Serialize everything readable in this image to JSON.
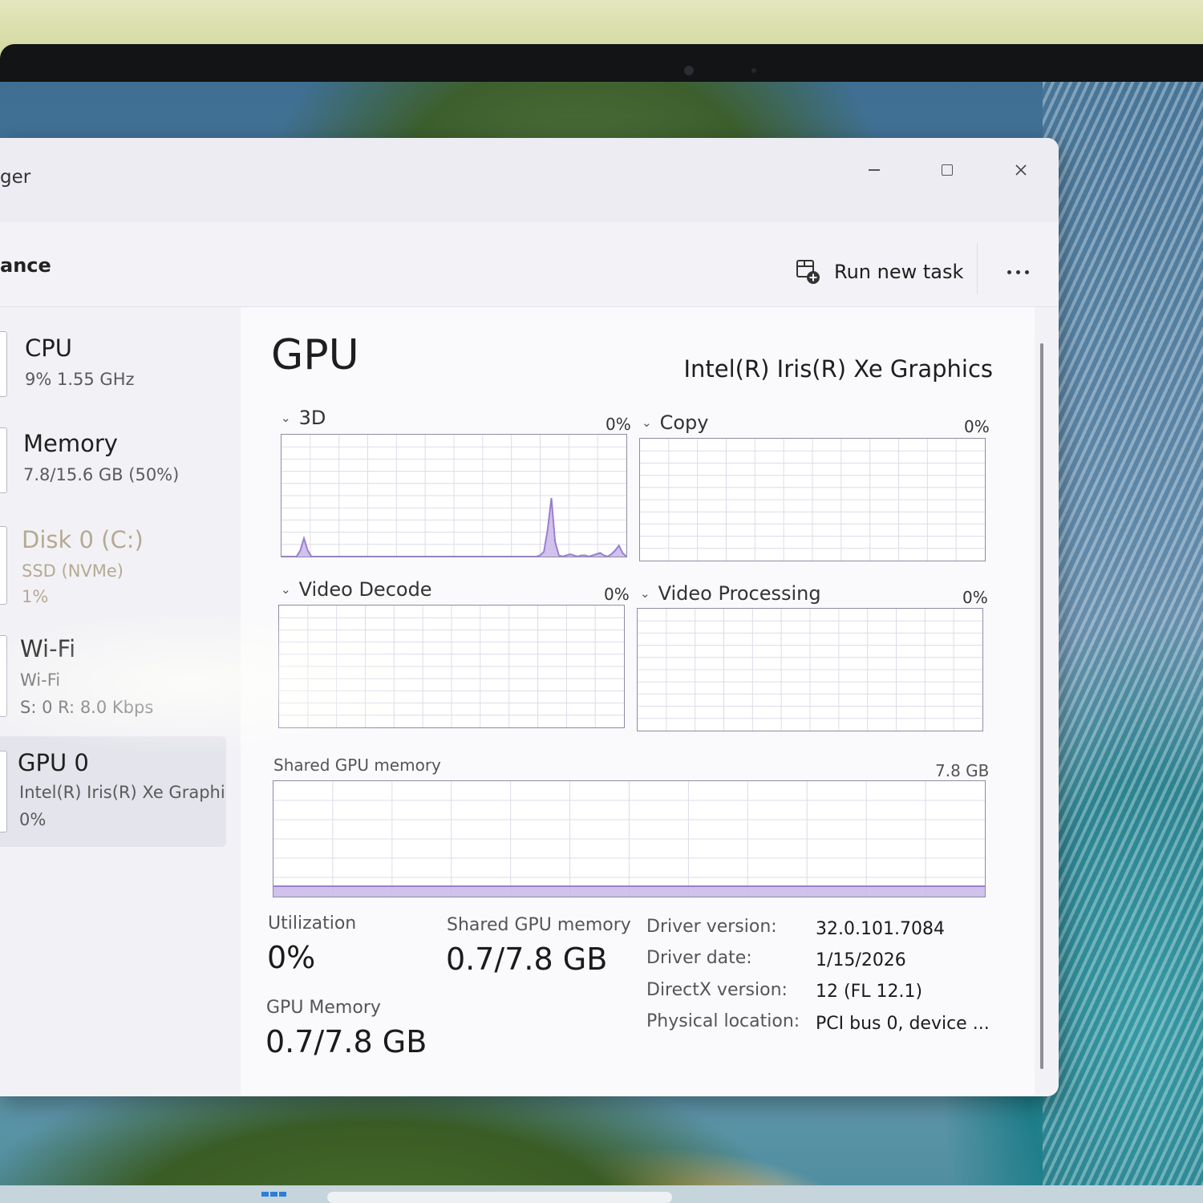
{
  "window": {
    "title": "ger",
    "controls": {
      "minimize": "minimize",
      "maximize": "maximize",
      "close": "close"
    }
  },
  "header": {
    "page_title": "ance",
    "run_new_task": "Run new task",
    "more_icon": "more-icon"
  },
  "sidebar": {
    "items": [
      {
        "name": "CPU",
        "line1": "9%  1.55 GHz"
      },
      {
        "name": "Memory",
        "line1": "7.8/15.6 GB (50%)"
      },
      {
        "name": "Disk 0 (C:)",
        "line1": "SSD (NVMe)",
        "line2": "1%"
      },
      {
        "name": "Wi-Fi",
        "line1": "Wi-Fi",
        "line2": "S: 0 R: 8.0 Kbps"
      },
      {
        "name": "GPU 0",
        "line1": "Intel(R) Iris(R) Xe Graphi",
        "line2": "0%"
      }
    ],
    "selected_index": 4
  },
  "gpu": {
    "title": "GPU",
    "adapter": "Intel(R) Iris(R) Xe Graphics",
    "engines": [
      {
        "label": "3D",
        "percent": "0%"
      },
      {
        "label": "Copy",
        "percent": "0%"
      },
      {
        "label": "Video Decode",
        "percent": "0%"
      },
      {
        "label": "Video Processing",
        "percent": "0%"
      }
    ],
    "shared_memory_graph": {
      "label": "Shared GPU memory",
      "max": "7.8 GB"
    },
    "stats": {
      "utilization_label": "Utilization",
      "utilization_value": "0%",
      "shared_label": "Shared GPU memory",
      "shared_value": "0.7/7.8 GB",
      "gpu_memory_label": "GPU Memory",
      "gpu_memory_value": "0.7/7.8 GB"
    },
    "details": [
      {
        "key": "Driver version:",
        "value": "32.0.101.7084"
      },
      {
        "key": "Driver date:",
        "value": "1/15/2026"
      },
      {
        "key": "DirectX version:",
        "value": "12 (FL 12.1)"
      },
      {
        "key": "Physical location:",
        "value": "PCI bus 0, device ..."
      }
    ]
  },
  "colors": {
    "graph_line": "#9b7fd0",
    "graph_fill": "#c9b6ea",
    "graph_grid": "#dcdce8",
    "graph_border": "#8c8ca6",
    "selected_bg": "#e4e4ec"
  },
  "chart_data": [
    {
      "type": "area",
      "name_ref": "3D",
      "series_fraction": [
        0,
        0,
        0,
        0,
        0,
        0.05,
        0.15,
        0.05,
        0,
        0,
        0,
        0,
        0,
        0,
        0,
        0,
        0,
        0,
        0,
        0,
        0,
        0,
        0,
        0,
        0,
        0,
        0,
        0,
        0,
        0,
        0,
        0,
        0,
        0,
        0,
        0,
        0,
        0,
        0,
        0,
        0,
        0,
        0,
        0,
        0,
        0,
        0,
        0,
        0,
        0,
        0,
        0,
        0,
        0,
        0,
        0,
        0,
        0,
        0,
        0,
        0,
        0,
        0,
        0,
        0,
        0,
        0,
        0,
        0,
        0.01,
        0.04,
        0.22,
        0.48,
        0.12,
        0.01,
        0,
        0.01,
        0.02,
        0.01,
        0,
        0.01,
        0.01,
        0,
        0.01,
        0.02,
        0.03,
        0.01,
        0,
        0.02,
        0.05,
        0.09,
        0.03,
        0
      ],
      "ylim": [
        0,
        1
      ]
    },
    {
      "type": "area",
      "name_ref": "Copy",
      "series_fraction": [],
      "ylim": [
        0,
        1
      ]
    },
    {
      "type": "area",
      "name_ref": "Video Decode",
      "series_fraction": [],
      "ylim": [
        0,
        1
      ]
    },
    {
      "type": "area",
      "name_ref": "Video Processing",
      "series_fraction": [],
      "ylim": [
        0,
        1
      ]
    },
    {
      "type": "area",
      "name_ref": "Shared GPU memory",
      "series_fraction": [
        0.09,
        0.09,
        0.09,
        0.09,
        0.09,
        0.09,
        0.09,
        0.09,
        0.09,
        0.09,
        0.09,
        0.09,
        0.09,
        0.09,
        0.09,
        0.09,
        0.09,
        0.09,
        0.09,
        0.09,
        0.09,
        0.09,
        0.09,
        0.09,
        0.09,
        0.09,
        0.09,
        0.09,
        0.09,
        0.09
      ],
      "ylim": [
        0,
        1
      ]
    }
  ]
}
